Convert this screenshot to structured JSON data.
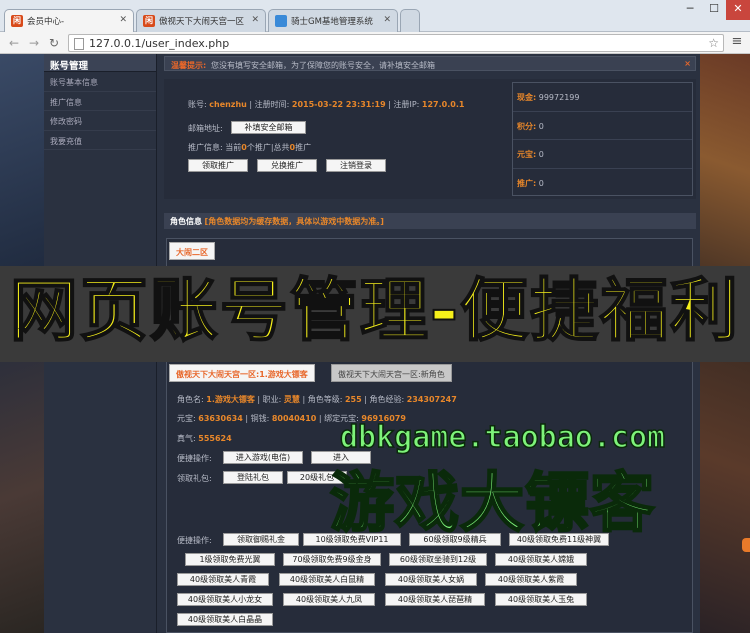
{
  "browser": {
    "tabs": [
      {
        "title": "会员中心-",
        "favicon": "闲",
        "favicon_color": "#d84a1a",
        "active": true
      },
      {
        "title": "傲视天下大闹天宫一区",
        "favicon": "闲",
        "favicon_color": "#d84a1a",
        "active": false
      },
      {
        "title": "骑士GM基地管理系统",
        "favicon": "",
        "favicon_color": "#3a8ad8",
        "active": false
      }
    ],
    "url": "127.0.0.1/user_index.php",
    "icons": {
      "back": "back-arrow-icon",
      "forward": "forward-arrow-icon",
      "reload": "reload-icon",
      "bookmark": "star-icon",
      "menu": "menu-icon"
    }
  },
  "sidebar": {
    "title": "账号管理",
    "items": [
      "账号基本信息",
      "推广信息",
      "修改密码",
      "我要充值"
    ]
  },
  "notice": {
    "label": "温馨提示:",
    "text": "您没有填写安全邮箱，为了保障您的账号安全，请补填安全邮箱",
    "close": "×"
  },
  "account": {
    "account_label": "账号:",
    "account_value": "chenzhu",
    "reg_time_label": "注册时间:",
    "reg_time_value": "2015-03-22 23:31:19",
    "reg_ip_label": "注册IP:",
    "reg_ip_value": "127.0.0.1",
    "email_label": "邮箱地址:",
    "email_button": "补填安全邮箱",
    "promo_prefix": "推广信息: 当前",
    "promo_current": "0",
    "promo_mid": "个推广",
    "promo_sep": "|",
    "promo_total_prefix": "总共",
    "promo_total": "0",
    "promo_suffix": "推广",
    "buttons": [
      "领取推广",
      "兑换推广",
      "注销登录"
    ]
  },
  "stats": [
    {
      "label": "现金:",
      "value": "99972199"
    },
    {
      "label": "积分:",
      "value": "0"
    },
    {
      "label": "元宝:",
      "value": "0"
    },
    {
      "label": "推广:",
      "value": "0"
    }
  ],
  "role": {
    "label": "角色信息",
    "note": "[角色数据均为缓存数据，具体以游戏中数据为准。]"
  },
  "server_tab": "大闹二区",
  "char_tabs": [
    "傲视天下大闹天宫一区:1.游戏大镖客",
    "傲视天下大闹天宫一区:新角色"
  ],
  "character": {
    "name_label": "角色名:",
    "name_value": "1.游戏大镖客",
    "job_label": "职业:",
    "job_value": "灵慧",
    "level_label": "角色等级:",
    "level_value": "255",
    "exp_label": "角色经验:",
    "exp_value": "234307247",
    "yb_label": "元宝:",
    "yb_value": "63630634",
    "money_label": "铜钱:",
    "money_value": "80040410",
    "bind_label": "绑定元宝:",
    "bind_value": "96916079",
    "qi_label": "真气:",
    "qi_value": "555624",
    "ops_label": "便捷操作:",
    "ops_buttons": [
      "进入游戏(电信)",
      "进入"
    ],
    "gift_label": "领取礼包:",
    "gift_buttons": [
      "登陆礼包",
      "20级礼包"
    ],
    "ops2_label": "便捷操作:",
    "ops2_buttons": [
      "领取御赐礼金",
      "10级领取免费VIP11",
      "60级领取9级精兵",
      "40级领取免费11级神翼",
      "1级领取免费光翼",
      "70级领取免费9级金身",
      "60级领取坐骑到12级",
      "40级领取美人嫦娥",
      "40级领取美人青霞",
      "40级领取美人白鼠精",
      "40级领取美人女娲",
      "40级领取美人紫霞",
      "40级领取美人小龙女",
      "40级领取美人九凤",
      "40级领取美人琵琶精",
      "40级领取美人玉兔",
      "40级领取美人白晶晶"
    ]
  },
  "overlay": {
    "banner": "网页账号管理-便捷福利",
    "watermark_url": "dbkgame.taobao.com",
    "watermark_name": "游戏大镖客"
  }
}
